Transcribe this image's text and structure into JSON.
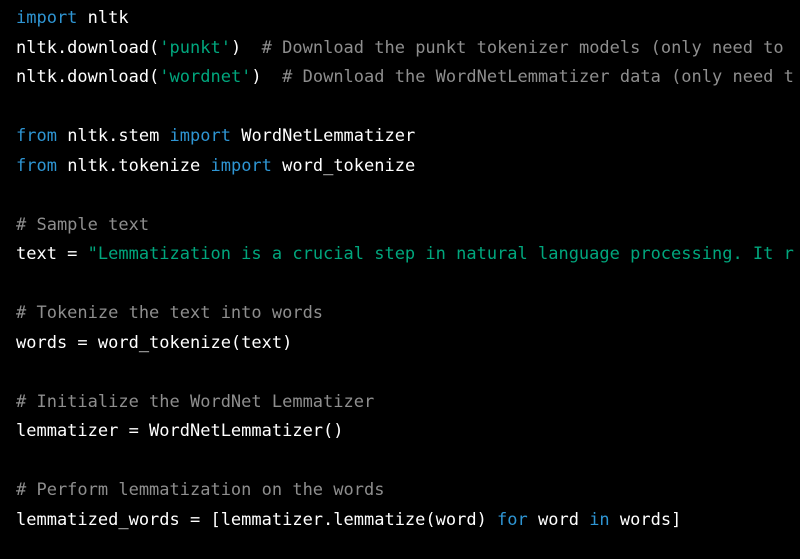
{
  "colors": {
    "background": "#000000",
    "keyword": "#2e95d3",
    "string": "#00a67d",
    "comment": "#8e8e8e",
    "text": "#ffffff"
  },
  "code": {
    "lines": [
      [
        {
          "t": "kw",
          "v": "import"
        },
        {
          "t": "plain",
          "v": " nltk"
        }
      ],
      [
        {
          "t": "plain",
          "v": "nltk.download("
        },
        {
          "t": "str",
          "v": "'punkt'"
        },
        {
          "t": "plain",
          "v": ")  "
        },
        {
          "t": "cmt",
          "v": "# Download the punkt tokenizer models (only need to"
        }
      ],
      [
        {
          "t": "plain",
          "v": "nltk.download("
        },
        {
          "t": "str",
          "v": "'wordnet'"
        },
        {
          "t": "plain",
          "v": ")  "
        },
        {
          "t": "cmt",
          "v": "# Download the WordNetLemmatizer data (only need t"
        }
      ],
      [],
      [
        {
          "t": "kw",
          "v": "from"
        },
        {
          "t": "plain",
          "v": " nltk.stem "
        },
        {
          "t": "kw",
          "v": "import"
        },
        {
          "t": "plain",
          "v": " WordNetLemmatizer"
        }
      ],
      [
        {
          "t": "kw",
          "v": "from"
        },
        {
          "t": "plain",
          "v": " nltk.tokenize "
        },
        {
          "t": "kw",
          "v": "import"
        },
        {
          "t": "plain",
          "v": " word_tokenize"
        }
      ],
      [],
      [
        {
          "t": "cmt",
          "v": "# Sample text"
        }
      ],
      [
        {
          "t": "plain",
          "v": "text = "
        },
        {
          "t": "str",
          "v": "\"Lemmatization is a crucial step in natural language processing. It r"
        }
      ],
      [],
      [
        {
          "t": "cmt",
          "v": "# Tokenize the text into words"
        }
      ],
      [
        {
          "t": "plain",
          "v": "words = word_tokenize(text)"
        }
      ],
      [],
      [
        {
          "t": "cmt",
          "v": "# Initialize the WordNet Lemmatizer"
        }
      ],
      [
        {
          "t": "plain",
          "v": "lemmatizer = WordNetLemmatizer()"
        }
      ],
      [],
      [
        {
          "t": "cmt",
          "v": "# Perform lemmatization on the words"
        }
      ],
      [
        {
          "t": "plain",
          "v": "lemmatized_words = [lemmatizer.lemmatize(word) "
        },
        {
          "t": "kw",
          "v": "for"
        },
        {
          "t": "plain",
          "v": " word "
        },
        {
          "t": "kw",
          "v": "in"
        },
        {
          "t": "plain",
          "v": " words]"
        }
      ]
    ]
  }
}
